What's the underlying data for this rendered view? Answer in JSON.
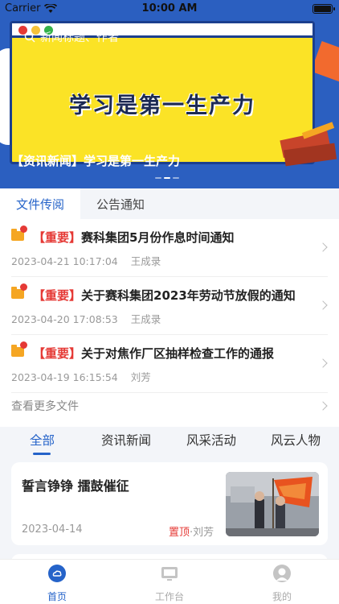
{
  "status_bar": {
    "carrier": "Carrier",
    "time": "10:00 AM"
  },
  "banner": {
    "title": "学习是第一生产力",
    "search_hint": "新闻标题、作者",
    "caption": "【资讯新闻】学习是第一生产力"
  },
  "doc_tabs": [
    {
      "label": "文件传阅",
      "active": true
    },
    {
      "label": "公告通知",
      "active": false
    }
  ],
  "documents": [
    {
      "tag": "【重要】",
      "title": "赛科集团5月份作息时间通知",
      "datetime": "2023-04-21 10:17:04",
      "author": "王成录"
    },
    {
      "tag": "【重要】",
      "title": "关于赛科集团2023年劳动节放假的通知",
      "datetime": "2023-04-20 17:08:53",
      "author": "王成录"
    },
    {
      "tag": "【重要】",
      "title": "关于对焦作厂区抽样检查工作的通报",
      "datetime": "2023-04-19 16:15:54",
      "author": "刘芳"
    }
  ],
  "more_files": "查看更多文件",
  "news_tabs": [
    {
      "label": "全部",
      "active": true
    },
    {
      "label": "资讯新闻",
      "active": false
    },
    {
      "label": "风采活动",
      "active": false
    },
    {
      "label": "风云人物",
      "active": false
    }
  ],
  "news_card": {
    "title": "誓言铮铮 擂鼓催征",
    "date": "2023-04-14",
    "pin_tag": "置顶",
    "separator": "·",
    "author": "刘芳"
  },
  "tab_bar": [
    {
      "label": "首页",
      "icon": "home-cloud-icon",
      "active": true
    },
    {
      "label": "工作台",
      "icon": "monitor-icon",
      "active": false
    },
    {
      "label": "我的",
      "icon": "person-icon",
      "active": false
    }
  ],
  "colors": {
    "accent": "#2563c9",
    "important": "#e53935",
    "banner_yellow": "#fbe326",
    "banner_blue": "#2b5fc0"
  }
}
